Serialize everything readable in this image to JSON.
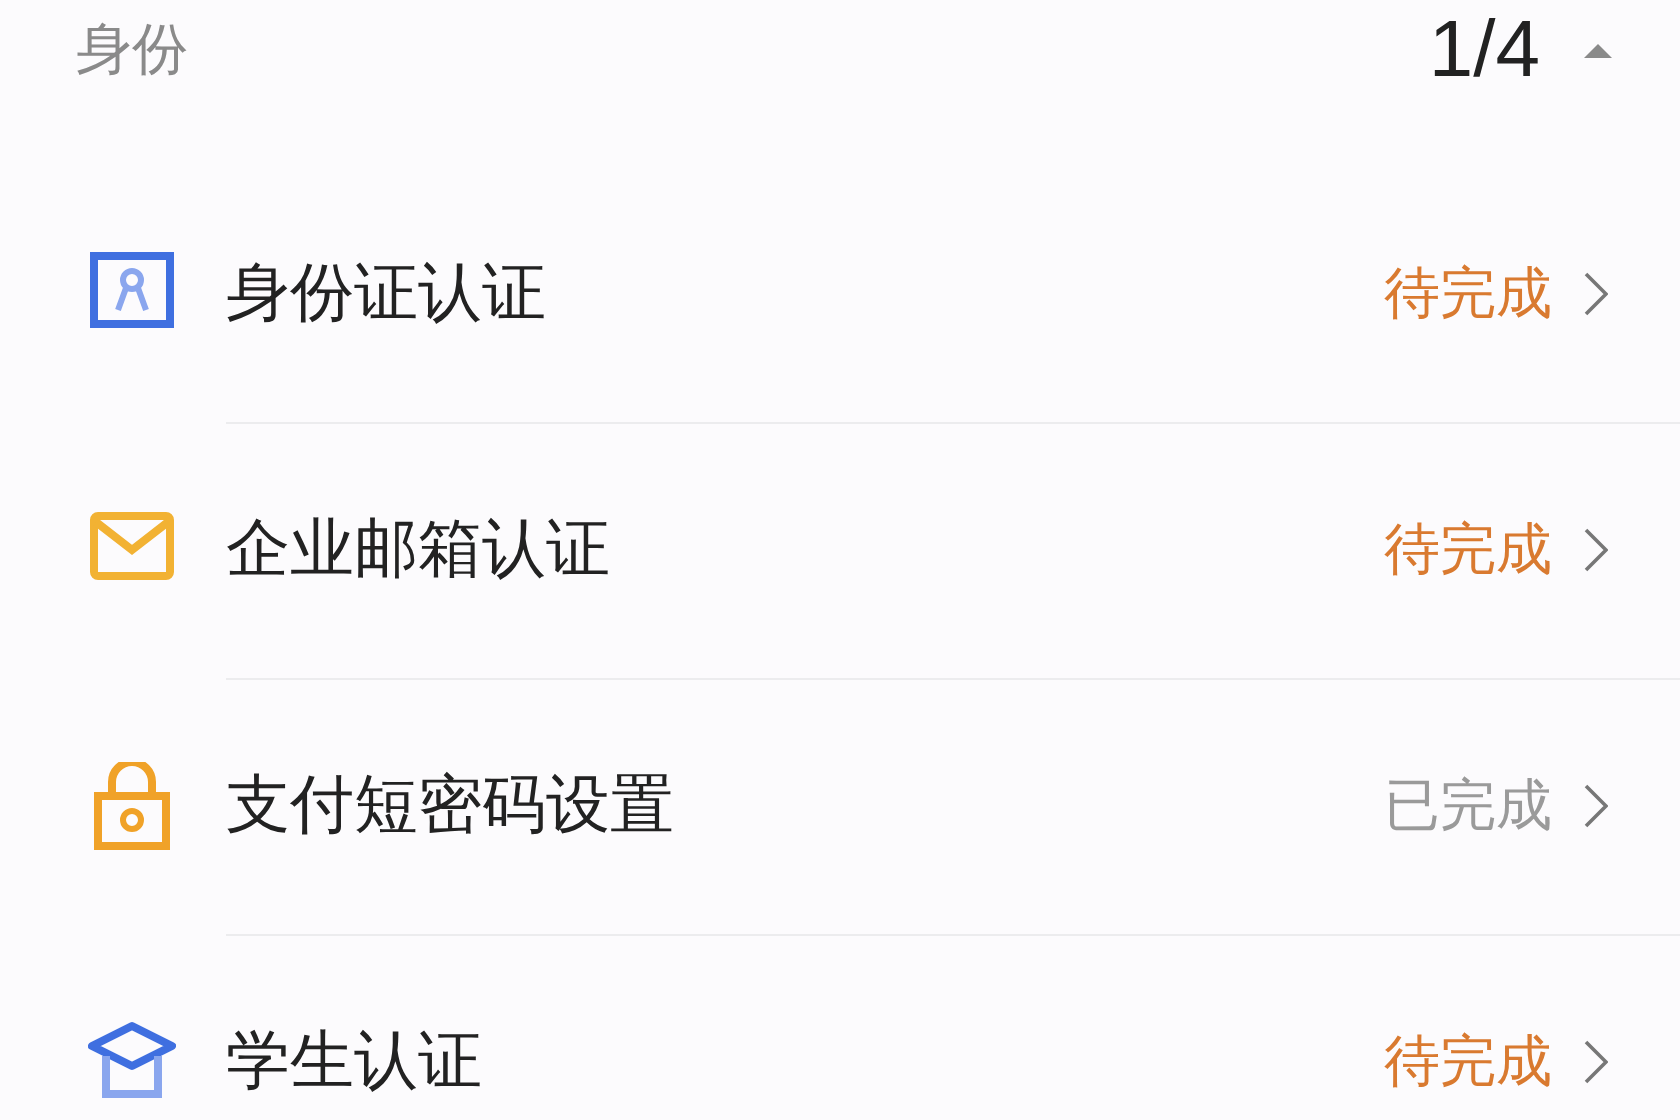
{
  "section": {
    "title": "身份",
    "progress": "1/4",
    "expanded": true
  },
  "items": [
    {
      "kind": "id-card",
      "label": "身份证认证",
      "status": "待完成",
      "done": false
    },
    {
      "kind": "mail",
      "label": "企业邮箱认证",
      "status": "待完成",
      "done": false
    },
    {
      "kind": "lock",
      "label": "支付短密码设置",
      "status": "已完成",
      "done": true
    },
    {
      "kind": "graduation",
      "label": "学生认证",
      "status": "待完成",
      "done": false
    }
  ]
}
